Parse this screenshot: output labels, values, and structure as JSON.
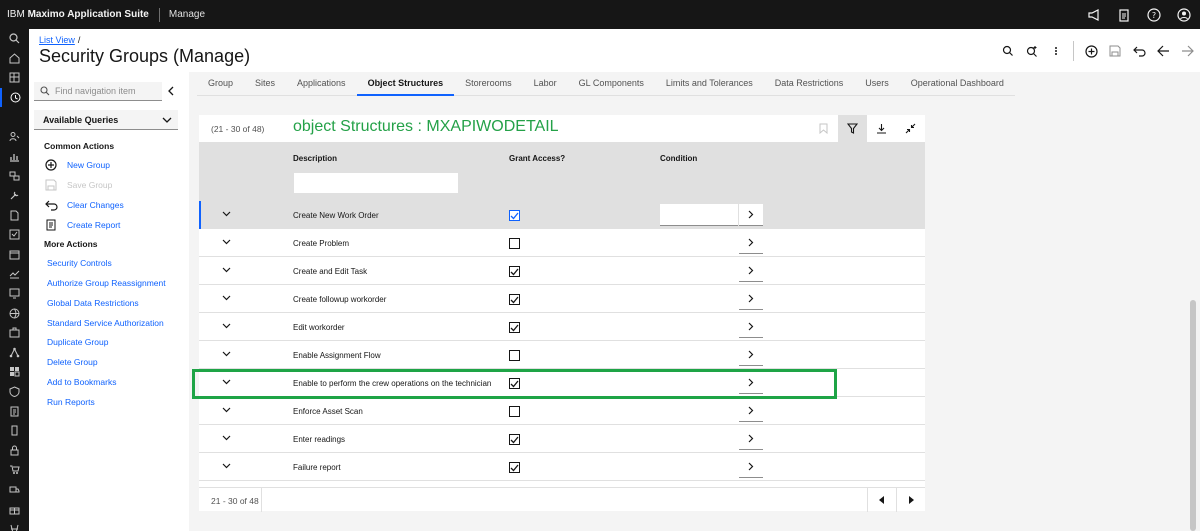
{
  "app": {
    "brand_prefix": "IBM ",
    "brand_name": "Maximo Application Suite",
    "module": "Manage",
    "top_icons": [
      "megaphone-icon",
      "clipboard-icon",
      "help-icon",
      "user-avatar-icon"
    ]
  },
  "rail": {
    "icons": [
      "search-icon",
      "home-icon",
      "dashboard-icon",
      "history-icon",
      "spacer",
      "people-icon",
      "chart-icon",
      "sync-icon",
      "tools-icon",
      "document-icon",
      "checklist-icon",
      "calendar-icon",
      "chart-icon",
      "monitor-icon",
      "globe-icon",
      "briefcase-icon",
      "network-icon",
      "grid-icon",
      "shield-icon",
      "report-icon",
      "mobile-icon",
      "lock-icon",
      "cart-icon",
      "truck-icon",
      "gift-icon",
      "collection-icon"
    ]
  },
  "header": {
    "breadcrumb_link": "List View",
    "breadcrumb_sep": "/",
    "title": "Security Groups (Manage)"
  },
  "sidebar": {
    "search_placeholder": "Find navigation item",
    "queries_label": "Available Queries",
    "common_actions_title": "Common Actions",
    "common_actions": [
      {
        "label": "New Group",
        "icon": "add-circle-icon",
        "enabled": true
      },
      {
        "label": "Save Group",
        "icon": "save-icon",
        "enabled": false
      },
      {
        "label": "Clear Changes",
        "icon": "undo-icon",
        "enabled": true
      },
      {
        "label": "Create Report",
        "icon": "report-icon",
        "enabled": true
      }
    ],
    "more_actions_title": "More Actions",
    "more_actions": [
      "Security Controls",
      "Authorize Group Reassignment",
      "Global Data Restrictions",
      "Standard Service Authorization",
      "Duplicate Group",
      "Delete Group",
      "Add to Bookmarks",
      "Run Reports"
    ]
  },
  "tabs": [
    {
      "label": "Group",
      "active": false
    },
    {
      "label": "Sites",
      "active": false
    },
    {
      "label": "Applications",
      "active": false
    },
    {
      "label": "Object Structures",
      "active": true
    },
    {
      "label": "Storerooms",
      "active": false
    },
    {
      "label": "Labor",
      "active": false
    },
    {
      "label": "GL Components",
      "active": false
    },
    {
      "label": "Limits and Tolerances",
      "active": false
    },
    {
      "label": "Data Restrictions",
      "active": false
    },
    {
      "label": "Users",
      "active": false
    },
    {
      "label": "Operational Dashboard",
      "active": false
    }
  ],
  "table": {
    "count": "(21 - 30 of 48)",
    "overlay_title": "object Structures : MXAPIWODETAIL",
    "columns": {
      "description": "Description",
      "grant": "Grant Access?",
      "condition": "Condition"
    },
    "rows": [
      {
        "description": "Create New Work Order",
        "granted": true
      },
      {
        "description": "Create Problem",
        "granted": false
      },
      {
        "description": "Create and Edit Task",
        "granted": true
      },
      {
        "description": "Create followup workorder",
        "granted": true
      },
      {
        "description": "Edit workorder",
        "granted": true
      },
      {
        "description": "Enable Assignment Flow",
        "granted": false
      },
      {
        "description": "Enable to perform the crew operations on the technician",
        "granted": true
      },
      {
        "description": "Enforce Asset Scan",
        "granted": false
      },
      {
        "description": "Enter readings",
        "granted": true
      },
      {
        "description": "Failure report",
        "granted": true
      }
    ],
    "footer_count": "21 - 30 of 48",
    "highlight_color": "#1ea446",
    "accent_color": "#0f62fe"
  }
}
